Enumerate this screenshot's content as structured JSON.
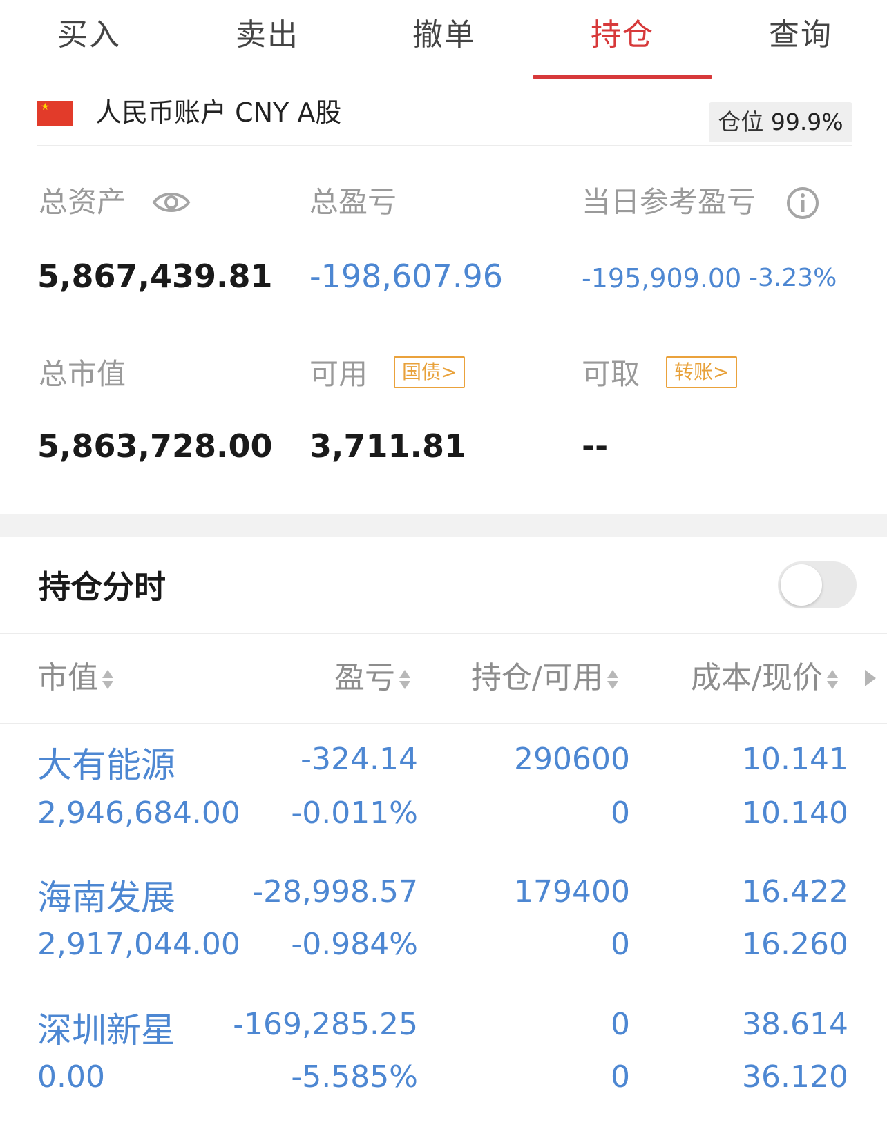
{
  "tabs": [
    {
      "label": "买入"
    },
    {
      "label": "卖出"
    },
    {
      "label": "撤单"
    },
    {
      "label": "持仓",
      "active": true
    },
    {
      "label": "查询"
    }
  ],
  "account": {
    "flag": "china-flag-icon",
    "label": "人民币账户 CNY A股",
    "position_label": "仓位",
    "position_value": "99.9%"
  },
  "summary": {
    "total_assets_label": "总资产",
    "total_assets_value": "5,867,439.81",
    "total_pl_label": "总盈亏",
    "total_pl_value": "-198,607.96",
    "daily_pl_label": "当日参考盈亏",
    "daily_pl_value": "-195,909.00",
    "daily_pl_pct": "-3.23%",
    "market_value_label": "总市值",
    "market_value_value": "5,863,728.00",
    "available_label": "可用",
    "available_tag": "国债>",
    "available_value": "3,711.81",
    "withdrawable_label": "可取",
    "withdrawable_tag": "转账>",
    "withdrawable_value": "--"
  },
  "holdings_section": {
    "title": "持仓分时",
    "toggle_on": false
  },
  "columns": [
    "市值",
    "盈亏",
    "持仓/可用",
    "成本/现价"
  ],
  "holdings": [
    {
      "name": "大有能源",
      "market_value": "2,946,684.00",
      "pl": "-324.14",
      "pl_pct": "-0.011%",
      "position": "290600",
      "available": "0",
      "cost": "10.141",
      "price": "10.140"
    },
    {
      "name": "海南发展",
      "market_value": "2,917,044.00",
      "pl": "-28,998.57",
      "pl_pct": "-0.984%",
      "position": "179400",
      "available": "0",
      "cost": "16.422",
      "price": "16.260"
    },
    {
      "name": "深圳新星",
      "market_value": "0.00",
      "pl": "-169,285.25",
      "pl_pct": "-5.585%",
      "position": "0",
      "available": "0",
      "cost": "38.614",
      "price": "36.120"
    }
  ],
  "colors": {
    "accent_red": "#d7393a",
    "value_blue": "#4d87d2",
    "tag_orange": "#e8a13a"
  }
}
